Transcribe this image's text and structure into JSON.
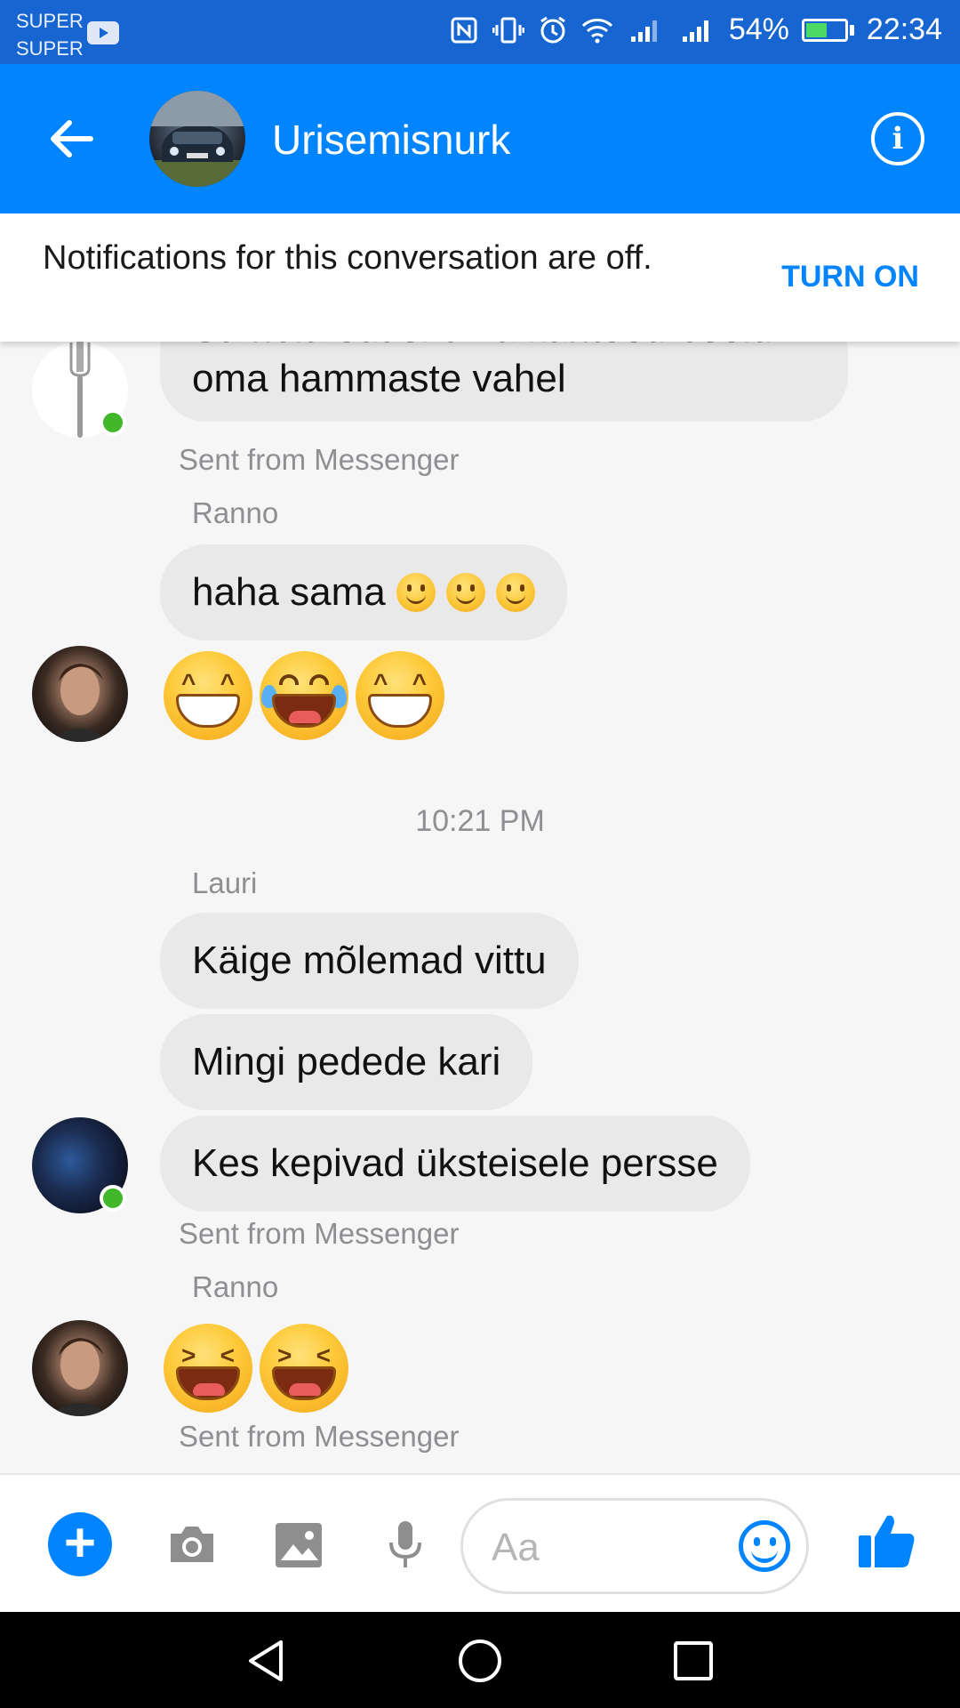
{
  "status_bar": {
    "carrier_1": "SUPER",
    "carrier_2": "SUPER",
    "battery": "54%",
    "time": "22:34"
  },
  "header": {
    "title": "Urisemisnurk"
  },
  "notification": {
    "text": "Notifications for this conversation are off.",
    "action": "TURN ON"
  },
  "messages": {
    "m1_text": "Sa hoia edasi oma kahteeuroseid oma hammaste vahel",
    "m1_sent_from": "Sent from Messenger",
    "m2_sender": "Ranno",
    "m2_text": "haha sama",
    "time_divider": "10:21 PM",
    "m3_sender": "Lauri",
    "m3_text": "Käige mõlemad vittu",
    "m4_text": "Mingi pedede kari",
    "m5_text": "Kes kepivad üksteisele persse",
    "m5_sent_from": "Sent from Messenger",
    "m6_sender": "Ranno",
    "m6_sent_from": "Sent from Messenger"
  },
  "composer": {
    "placeholder": "Aa"
  },
  "colors": {
    "brand": "#0084ff",
    "bubble": "#e9e9e9",
    "online": "#42b72a"
  },
  "icons": {
    "back": "arrow-left-icon",
    "info": "info-icon",
    "add": "plus-icon",
    "camera": "camera-icon",
    "gallery": "image-icon",
    "mic": "microphone-icon",
    "emoji": "smiley-icon",
    "like": "thumbs-up-icon"
  }
}
